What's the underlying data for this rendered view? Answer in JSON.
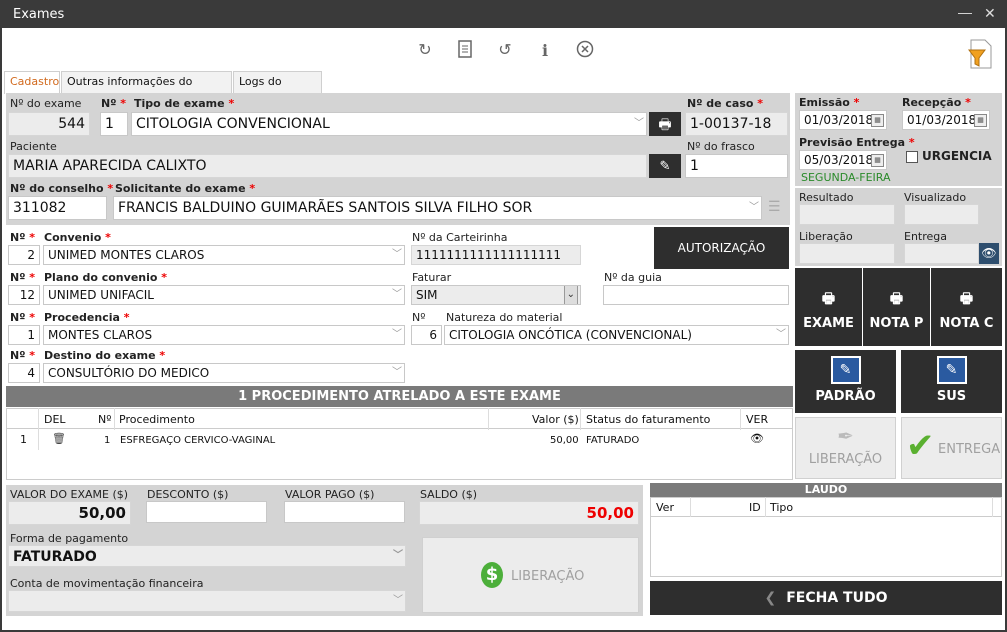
{
  "window": {
    "title": "Exames"
  },
  "tabs": [
    "Cadastro",
    "Outras informações do exame",
    "Logs do exame"
  ],
  "exam": {
    "num_label": "Nº do exame",
    "num": "544",
    "n_label": "Nº",
    "n": "1",
    "tipo_label": "Tipo de exame",
    "tipo": "CITOLOGIA CONVENCIONAL",
    "caso_label": "Nº de caso",
    "caso": "1-00137-18",
    "paciente_label": "Paciente",
    "paciente": "MARIA APARECIDA CALIXTO",
    "frasco_label": "Nº do frasco",
    "frasco": "1",
    "conselho_label": "Nº do conselho",
    "conselho": "311082",
    "solicitante_label": "Solicitante do exame",
    "solicitante": "FRANCIS BALDUINO GUIMARÃES SANTOIS SILVA FILHO SOR"
  },
  "dates": {
    "emissao_label": "Emissão",
    "emissao": "01/03/2018",
    "recepcao_label": "Recepção",
    "recepcao": "01/03/2018",
    "previsao_label": "Previsão Entrega",
    "previsao": "05/03/2018",
    "weekday": "SEGUNDA-FEIRA",
    "urgencia_label": "URGENCIA"
  },
  "status": {
    "resultado": "Resultado",
    "visualizado": "Visualizado",
    "liberacao": "Liberação",
    "entrega": "Entrega"
  },
  "convenio": {
    "n_label": "Nº",
    "n": "2",
    "label": "Convenio",
    "value": "UNIMED MONTES CLAROS",
    "carteirinha_label": "Nº da Carteirinha",
    "carteirinha": "1111111111111111111",
    "autorizacao": "AUTORIZAÇÃO"
  },
  "plano": {
    "n_label": "Nº",
    "n": "12",
    "label": "Plano do convenio",
    "value": "UNIMED UNIFACIL",
    "faturar_label": "Faturar",
    "faturar": "SIM",
    "guia_label": "Nº da guia",
    "guia": ""
  },
  "procedencia": {
    "n_label": "Nº",
    "n": "1",
    "label": "Procedencia",
    "value": "MONTES CLAROS",
    "nat_n_label": "Nº",
    "nat_n": "6",
    "nat_label": "Natureza do material",
    "nat": "CITOLOGIA ONCÓTICA (CONVENCIONAL)"
  },
  "destino": {
    "n_label": "Nº",
    "n": "4",
    "label": "Destino do exame",
    "value": "CONSULTÓRIO DO MEDICO"
  },
  "print_buttons": [
    "EXAME",
    "NOTA P",
    "NOTA C"
  ],
  "action_buttons": {
    "padrao": "PADRÃO",
    "sus": "SUS",
    "liberacao": "LIBERAÇÃO",
    "entrega": "ENTREGA"
  },
  "procedures": {
    "header": "1 PROCEDIMENTO ATRELADO A ESTE EXAME",
    "columns": [
      "DEL",
      "Nº",
      "Procedimento",
      "Valor ($)",
      "Status do faturamento",
      "VER"
    ],
    "rows": [
      {
        "idx": "1",
        "n": "1",
        "proc": "ESFREGAÇO CERVICO-VAGINAL",
        "valor": "50,00",
        "status": "FATURADO"
      }
    ]
  },
  "payment": {
    "valor_label": "VALOR DO EXAME ($)",
    "valor": "50,00",
    "desconto_label": "DESCONTO ($)",
    "desconto": "",
    "pago_label": "VALOR PAGO ($)",
    "pago": "",
    "saldo_label": "SALDO ($)",
    "saldo": "50,00",
    "forma_label": "Forma de pagamento",
    "forma": "FATURADO",
    "conta_label": "Conta de movimentação financeira",
    "conta": "",
    "liberacao_btn": "LIBERAÇÃO"
  },
  "laudo": {
    "header": "LAUDO",
    "columns": [
      "Ver",
      "ID",
      "Tipo"
    ]
  },
  "fecha_tudo": "FECHA TUDO",
  "colors": {
    "accent": "#d26a1e",
    "dark": "#2e2e2e",
    "required": "#e00000",
    "saldo": "#e00000",
    "weekday": "#2a8a2a"
  }
}
